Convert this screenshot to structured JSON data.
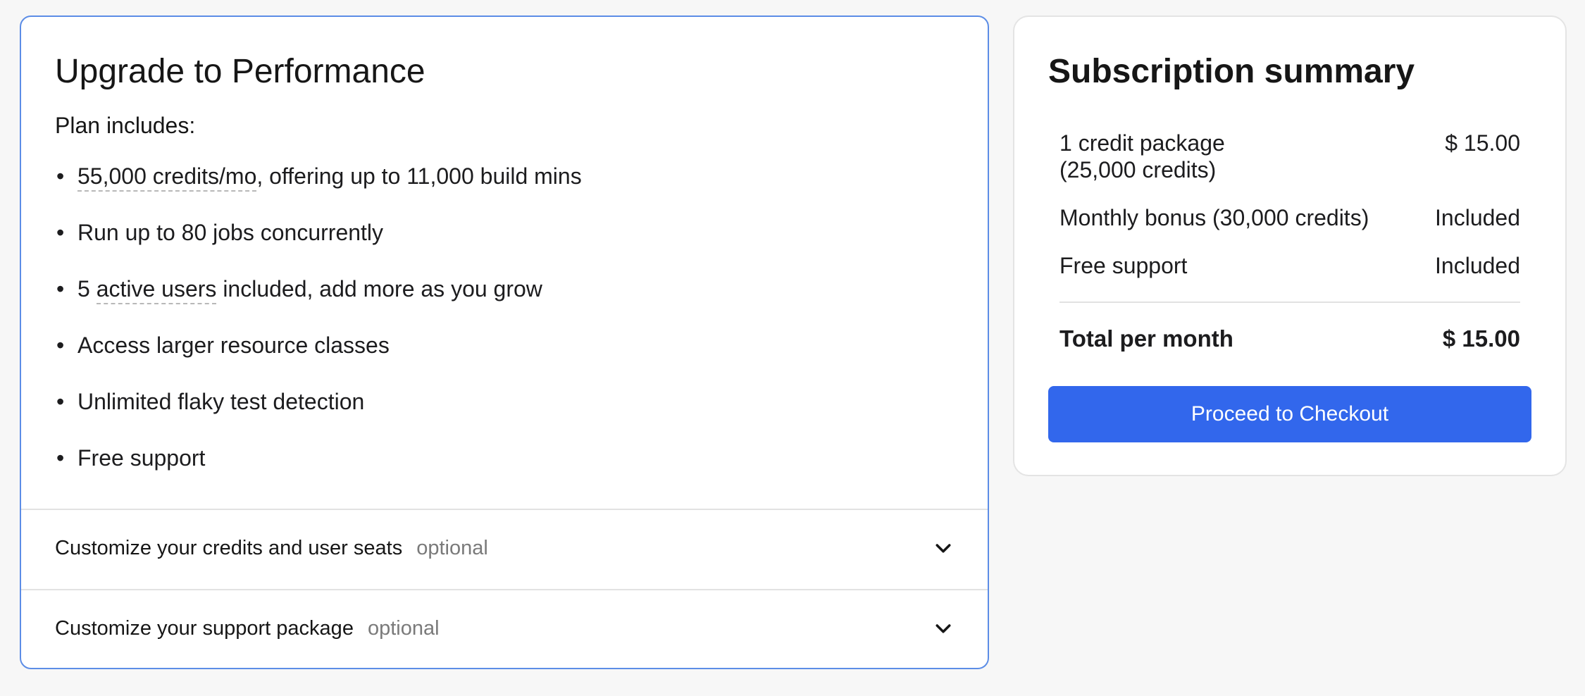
{
  "plan": {
    "title": "Upgrade to Performance",
    "includes_label": "Plan includes:",
    "features": [
      {
        "underlined": "55,000 credits/mo",
        "rest": ", offering up to 11,000 build mins"
      },
      {
        "pre": "",
        "text": "Run up to 80 jobs concurrently"
      },
      {
        "pre": "5 ",
        "underlined": "active users",
        "rest": " included, add more as you grow"
      },
      {
        "text": "Access larger resource classes"
      },
      {
        "text": "Unlimited flaky test detection"
      },
      {
        "text": "Free support"
      }
    ],
    "bullet": "•",
    "accordions": [
      {
        "label": "Customize your credits and user seats",
        "tag": "optional",
        "icon": "chevron-down-icon"
      },
      {
        "label": "Customize your support package",
        "tag": "optional",
        "icon": "chevron-down-icon"
      }
    ]
  },
  "summary": {
    "title": "Subscription summary",
    "rows": [
      {
        "label_line1": "1 credit package",
        "label_line2": "(25,000 credits)",
        "value": "$ 15.00"
      },
      {
        "label": "Monthly bonus (30,000 credits)",
        "value": "Included"
      },
      {
        "label": "Free support",
        "value": "Included"
      }
    ],
    "total": {
      "label": "Total per month",
      "value": "$ 15.00"
    },
    "checkout_label": "Proceed to Checkout"
  },
  "colors": {
    "accent": "#3267ec",
    "card_border_active": "#5c8de6",
    "muted_text": "#7a7a7a"
  }
}
